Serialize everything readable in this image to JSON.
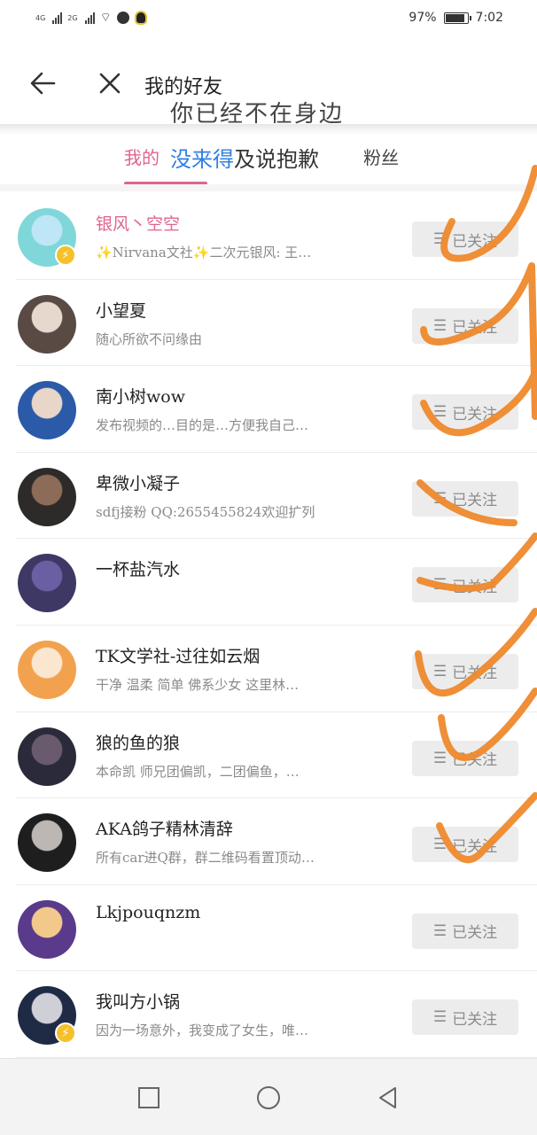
{
  "status_bar": {
    "net1": "4G",
    "net2": "2G",
    "battery": "97%",
    "battery_level": 0.97,
    "time": "7:02"
  },
  "header": {
    "title": "我的好友",
    "overlay_text_top": "你已经不在身边"
  },
  "tabs": {
    "mine_label": "我的",
    "fans_label": "粉丝",
    "overlay_blue": "没来得",
    "overlay_dark": "及说抱歉"
  },
  "friends": [
    {
      "name": "银风丶空空",
      "desc": "✨Nirvana文社✨二次元银风: 王…",
      "button": "已关注",
      "verified": true,
      "highlight": true
    },
    {
      "name": "小望夏",
      "desc": "随心所欲不问缘由",
      "button": "已关注",
      "verified": false,
      "highlight": false
    },
    {
      "name": "南小树wow",
      "desc": "发布视频的…目的是…方便我自己…",
      "button": "已关注",
      "verified": false,
      "highlight": false
    },
    {
      "name": "卑微小凝子",
      "desc": "sdfj接粉 QQ:2655455824欢迎扩列",
      "button": "已关注",
      "verified": false,
      "highlight": false
    },
    {
      "name": "一杯盐汽水",
      "desc": "",
      "button": "已关注",
      "verified": false,
      "highlight": false
    },
    {
      "name": "TK文学社-过往如云烟",
      "desc": "干净 温柔 简单 佛系少女 这里林…",
      "button": "已关注",
      "verified": false,
      "highlight": false
    },
    {
      "name": "狼的鱼的狼",
      "desc": "本命凯 师兄团偏凯，二团偏鱼，…",
      "button": "已关注",
      "verified": false,
      "highlight": false
    },
    {
      "name": "AKA鸽子精林清辞",
      "desc": "所有car进Q群，群二维码看置顶动…",
      "button": "已关注",
      "verified": false,
      "highlight": false
    },
    {
      "name": "Lkjpouqnzm",
      "desc": "",
      "button": "已关注",
      "verified": false,
      "highlight": false
    },
    {
      "name": "我叫方小锅",
      "desc": "因为一场意外，我变成了女生，唯…",
      "button": "已关注",
      "verified": true,
      "highlight": false
    }
  ],
  "icons": {
    "back": "arrow-left-icon",
    "close": "close-icon",
    "menu": "menu-lines-icon",
    "nav_recent": "square-icon",
    "nav_home": "circle-icon",
    "nav_back": "triangle-back-icon"
  },
  "colors": {
    "accent_pink": "#e0658c",
    "handwriting_orange": "#ef8a2e",
    "handwriting_blue": "#2f7fe0",
    "button_bg": "#ececec"
  }
}
